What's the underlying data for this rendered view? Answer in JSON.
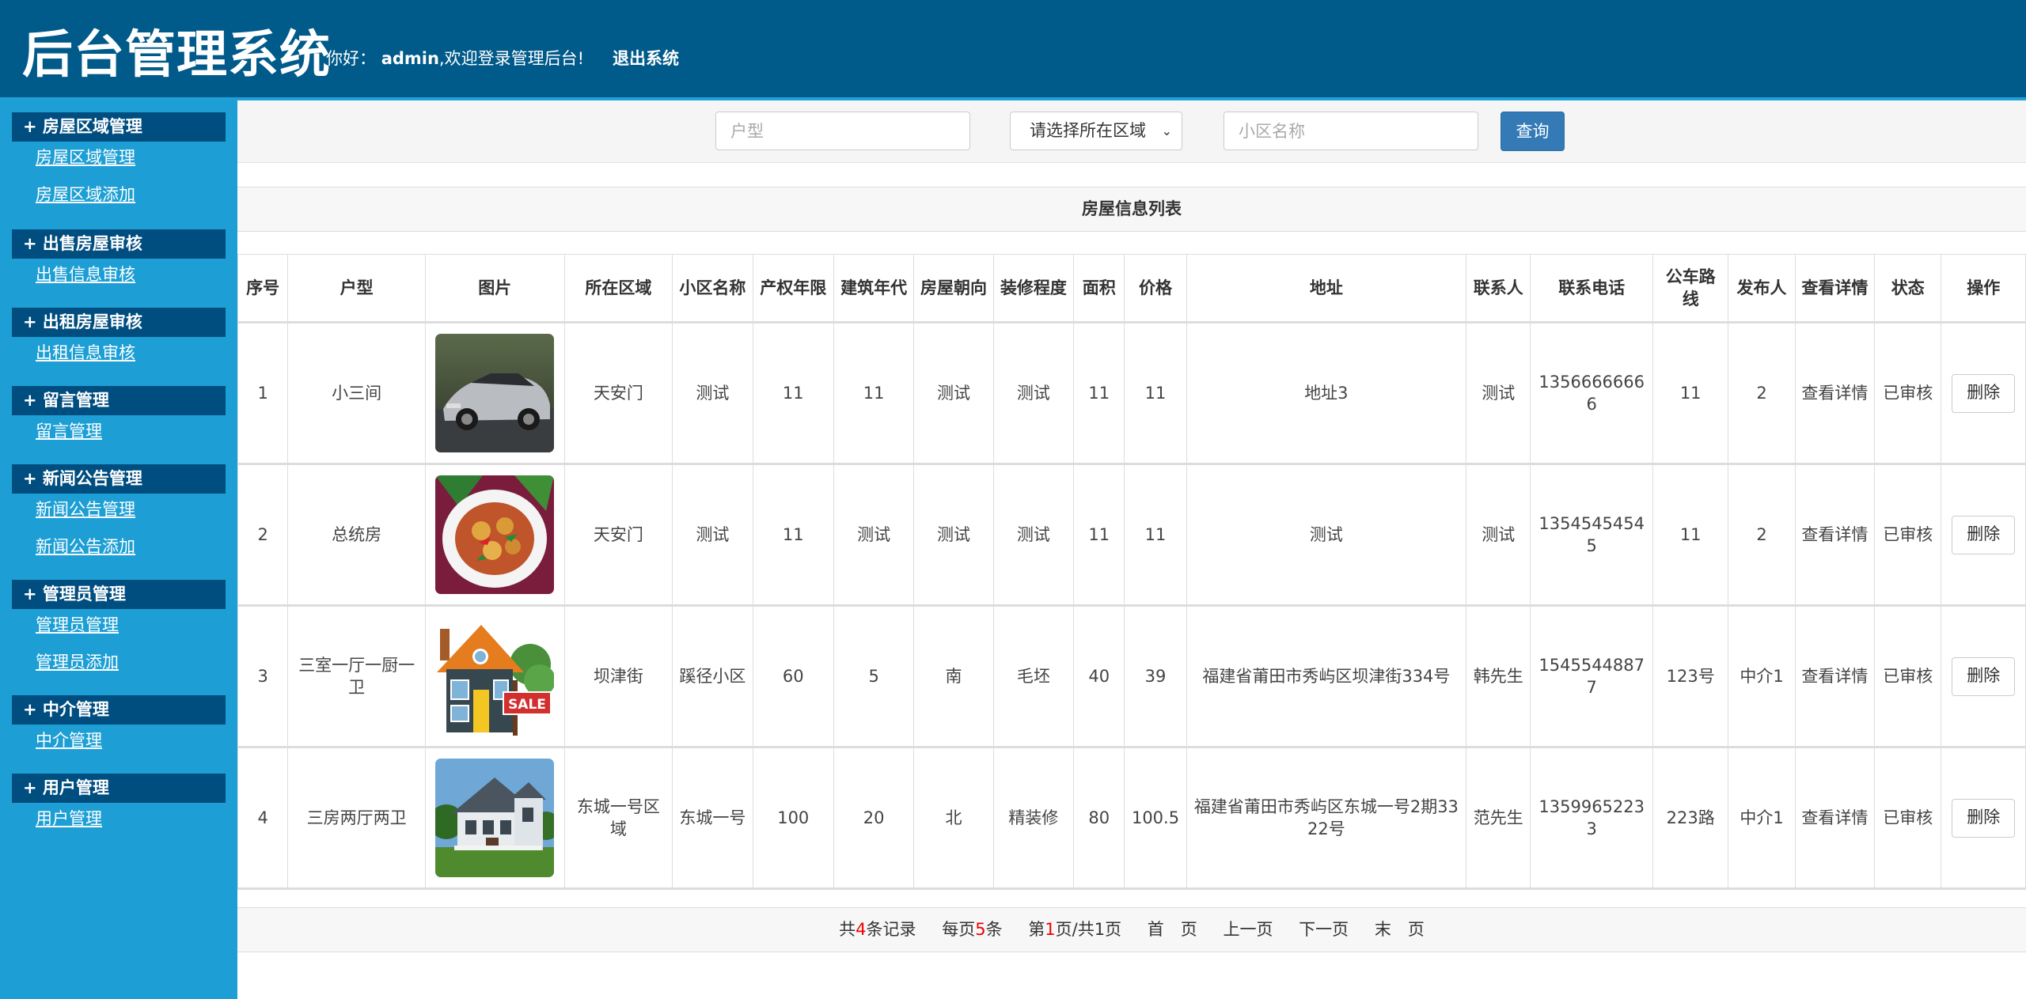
{
  "header": {
    "title": "后台管理系统",
    "greet_prefix": "你好：",
    "username": "admin",
    "greet_suffix": ",欢迎登录管理后台!",
    "logout": "退出系统"
  },
  "sidebar": [
    {
      "title": "+ 房屋区域管理",
      "items": [
        "房屋区域管理",
        "房屋区域添加"
      ]
    },
    {
      "title": "+ 出售房屋审核",
      "items": [
        "出售信息审核"
      ]
    },
    {
      "title": "+ 出租房屋审核",
      "items": [
        "出租信息审核"
      ]
    },
    {
      "title": "+ 留言管理",
      "items": [
        "留言管理"
      ]
    },
    {
      "title": "+ 新闻公告管理",
      "items": [
        "新闻公告管理",
        "新闻公告添加"
      ]
    },
    {
      "title": "+ 管理员管理",
      "items": [
        "管理员管理",
        "管理员添加"
      ]
    },
    {
      "title": "+ 中介管理",
      "items": [
        "中介管理"
      ]
    },
    {
      "title": "+ 用户管理",
      "items": [
        "用户管理"
      ]
    }
  ],
  "search": {
    "type_placeholder": "户型",
    "area_select": "请选择所在区域",
    "community_placeholder": "小区名称",
    "query_button": "查询"
  },
  "list_title": "房屋信息列表",
  "table": {
    "headers": [
      "序号",
      "户型",
      "图片",
      "所在区域",
      "小区名称",
      "产权年限",
      "建筑年代",
      "房屋朝向",
      "装修程度",
      "面积",
      "价格",
      "地址",
      "联系人",
      "联系电话",
      "公车路线",
      "发布人",
      "查看详情",
      "状态",
      "操作"
    ],
    "rows": [
      {
        "no": "1",
        "type": "小三间",
        "image": "car-photo",
        "area": "天安门",
        "community": "测试",
        "years": "11",
        "built": "11",
        "facing": "测试",
        "decor": "测试",
        "size": "11",
        "price": "11",
        "address": "地址3",
        "contact": "测试",
        "phone": "13566666666",
        "bus": "11",
        "publisher": "2",
        "detail": "查看详情",
        "status": "已审核",
        "action": "删除"
      },
      {
        "no": "2",
        "type": "总统房",
        "image": "food-photo",
        "area": "天安门",
        "community": "测试",
        "years": "11",
        "built": "测试",
        "facing": "测试",
        "decor": "测试",
        "size": "11",
        "price": "11",
        "address": "测试",
        "contact": "测试",
        "phone": "13545454545",
        "bus": "11",
        "publisher": "2",
        "detail": "查看详情",
        "status": "已审核",
        "action": "删除"
      },
      {
        "no": "3",
        "type": "三室一厅一厨一卫",
        "image": "house-sale-illustration",
        "area": "坝津街",
        "community": "蹊径小区",
        "years": "60",
        "built": "5",
        "facing": "南",
        "decor": "毛坯",
        "size": "40",
        "price": "39",
        "address": "福建省莆田市秀屿区坝津街334号",
        "contact": "韩先生",
        "phone": "15455448877",
        "bus": "123号",
        "publisher": "中介1",
        "detail": "查看详情",
        "status": "已审核",
        "action": "删除"
      },
      {
        "no": "4",
        "type": "三房两厅两卫",
        "image": "house-photo",
        "area": "东城一号区域",
        "community": "东城一号",
        "years": "100",
        "built": "20",
        "facing": "北",
        "decor": "精装修",
        "size": "80",
        "price": "100.5",
        "address": "福建省莆田市秀屿区东城一号2期3322号",
        "contact": "范先生",
        "phone": "13599652233",
        "bus": "223路",
        "publisher": "中介1",
        "detail": "查看详情",
        "status": "已审核",
        "action": "删除"
      }
    ]
  },
  "pager": {
    "total_prefix": "共",
    "total": "4",
    "total_suffix": "条记录",
    "per_prefix": "每页",
    "per": "5",
    "per_suffix": "条",
    "page_prefix": "第",
    "page": "1",
    "page_suffix": "页/共1页",
    "first": "首　页",
    "prev": "上一页",
    "next": "下一页",
    "last": "末　页"
  },
  "colors": {
    "header_bg": "#005a8a",
    "sidebar_bg": "#1d9fd5",
    "sidebar_head": "#004d80",
    "button_blue": "#337ab7"
  }
}
